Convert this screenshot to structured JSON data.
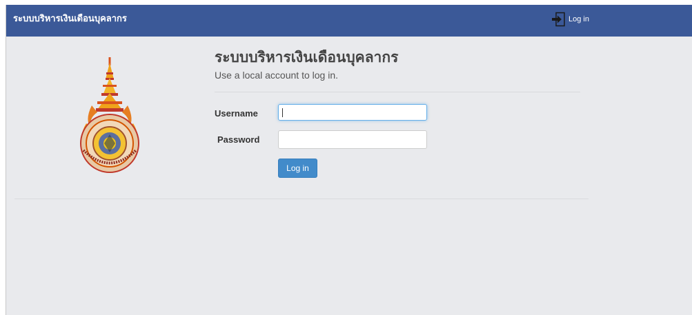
{
  "navbar": {
    "brand": "ระบบบริหารเงินเดือนบุคลากร",
    "login_link": "Log in",
    "login_icon": "sign-in-icon",
    "color": "#3b5998"
  },
  "logo": {
    "icon": "university-seal-logo"
  },
  "main": {
    "title": "ระบบบริหารเงินเดือนบุคลากร",
    "subtitle": "Use a local account to log in."
  },
  "form": {
    "username_label": "Username",
    "password_label": "Password",
    "username_value": "",
    "password_value": "",
    "submit_label": "Log in",
    "button_color": "#428bca"
  }
}
